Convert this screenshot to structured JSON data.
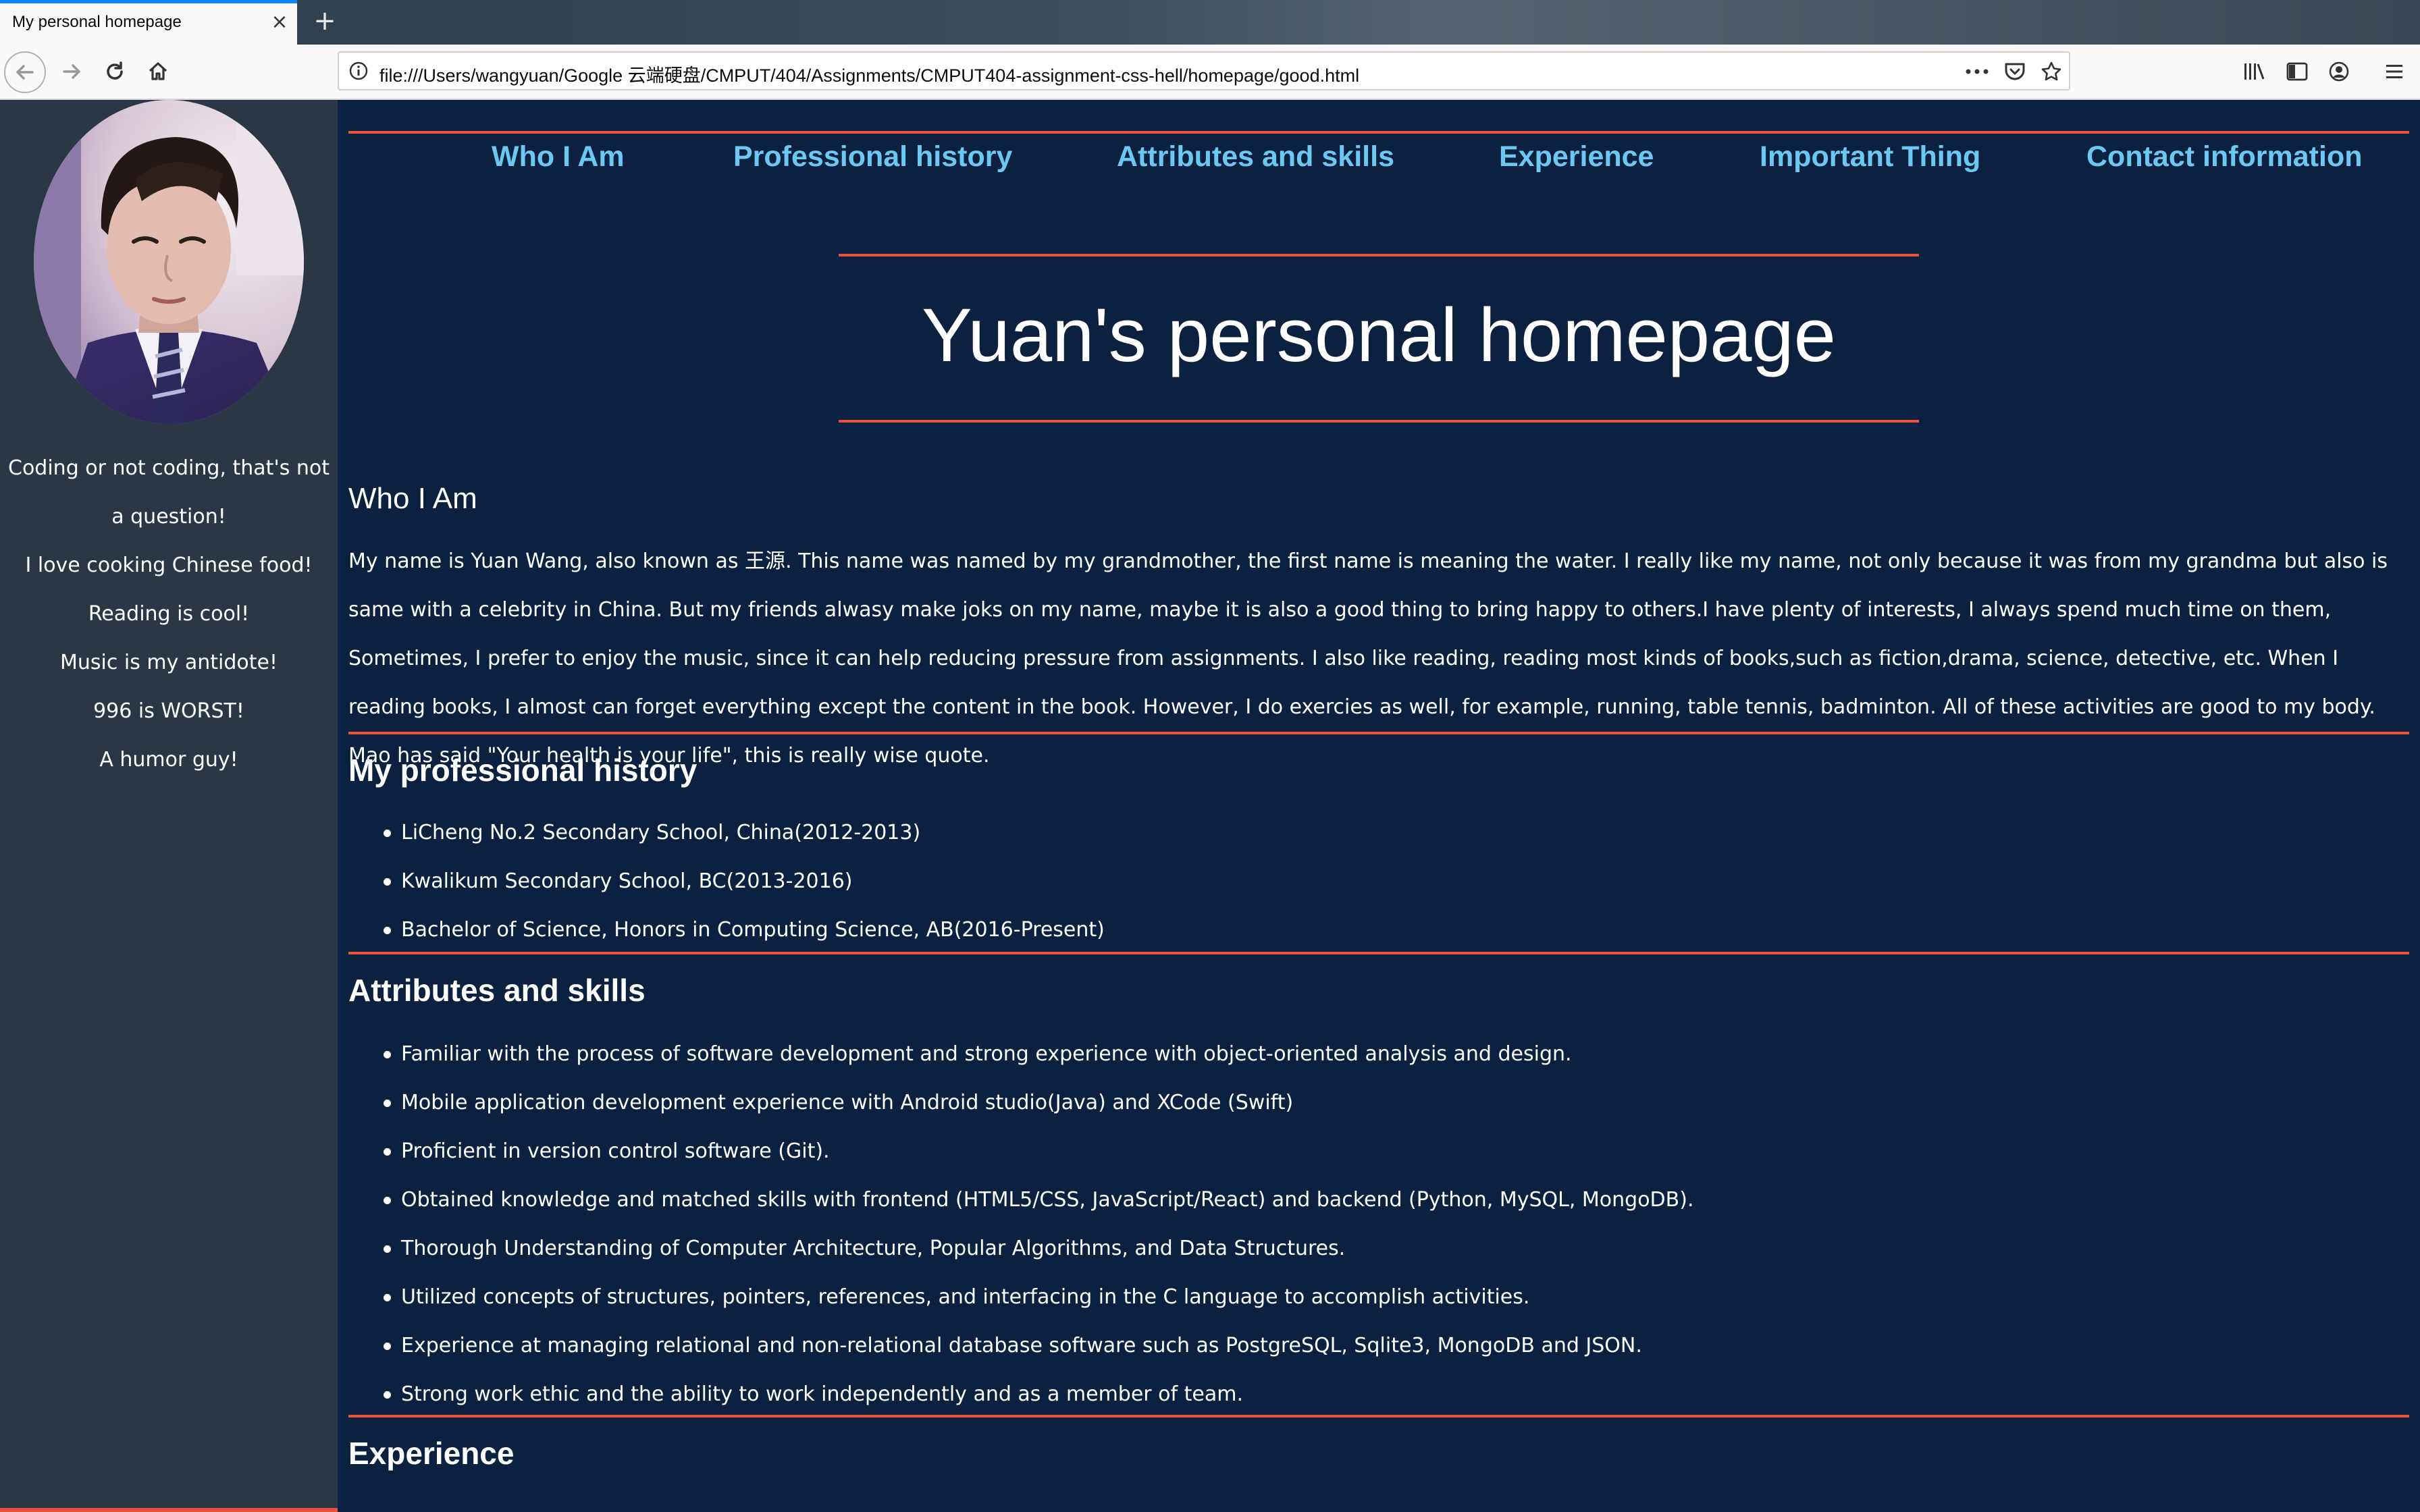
{
  "browser": {
    "tab_title": "My personal homepage",
    "tab_close": "×",
    "new_tab": "+",
    "url": "file:///Users/wangyuan/Google 云端硬盘/CMPUT/404/Assignments/CMPUT404-assignment-css-hell/homepage/good.html",
    "icons": [
      "back-icon",
      "forward-icon",
      "reload-icon",
      "home-icon",
      "info-icon",
      "more-icon",
      "pocket-icon",
      "star-icon",
      "library-icon",
      "sidebar-icon",
      "account-icon",
      "menu-icon"
    ]
  },
  "sidebar": {
    "quotes": [
      "Coding or not coding, that's not a question!",
      "I love cooking Chinese food!",
      "Reading is cool!",
      "Music is my antidote!",
      "996 is WORST!",
      "A humor guy!"
    ]
  },
  "nav": {
    "links": [
      "Who I Am",
      "Professional history",
      "Attributes and skills",
      "Experience",
      "Important Thing",
      "Contact information"
    ]
  },
  "page": {
    "title": "Yuan's personal homepage",
    "who": {
      "heading": "Who I Am",
      "text": "My name is Yuan Wang, also known as 王源. This name was named by my grandmother, the first name is meaning the water. I really like my name, not only because it was from my grandma but also is same with a celebrity in China. But my friends alwasy make joks on my name, maybe it is also a good thing to bring happy to others.I have plenty of interests, I always spend much time on them, Sometimes, I prefer to enjoy the music, since it can help reducing pressure from assignments. I also like reading, reading most kinds of books,such as fiction,drama, science, detective, etc. When I reading books, I almost can forget everything except the content in the book. However, I do exercies as well, for example, running, table tennis, badminton. All of these activities are good to my body. Mao has said \"Your health is your life\", this is really wise quote."
    },
    "history": {
      "heading": "My professional history",
      "items": [
        "LiCheng No.2 Secondary School, China(2012-2013)",
        "Kwalikum Secondary School, BC(2013-2016)",
        "Bachelor of Science, Honors in Computing Science, AB(2016-Present)"
      ]
    },
    "skills": {
      "heading": "Attributes and skills",
      "items": [
        "Familiar with the process of software development and strong experience with object-oriented analysis and design.",
        "Mobile application development experience with Android studio(Java) and XCode (Swift)",
        "Proficient in version control software (Git).",
        "Obtained knowledge and matched skills with frontend (HTML5/CSS, JavaScript/React) and backend (Python, MySQL, MongoDB).",
        "Thorough Understanding of Computer Architecture, Popular Algorithms, and Data Structures.",
        "Utilized concepts of structures, pointers, references, and interfacing in the C language to accomplish activities.",
        "Experience at managing relational and non-relational database software such as PostgreSQL, Sqlite3, MongoDB and JSON.",
        "Strong work ethic and the ability to work independently and as a member of team."
      ]
    },
    "experience": {
      "heading": "Experience"
    }
  },
  "colors": {
    "page_bg": "#0c2140",
    "sidebar_bg": "#2b3745",
    "accent_line": "#e8533c",
    "nav_link": "#6bc8f3",
    "text": "#ffffff"
  }
}
